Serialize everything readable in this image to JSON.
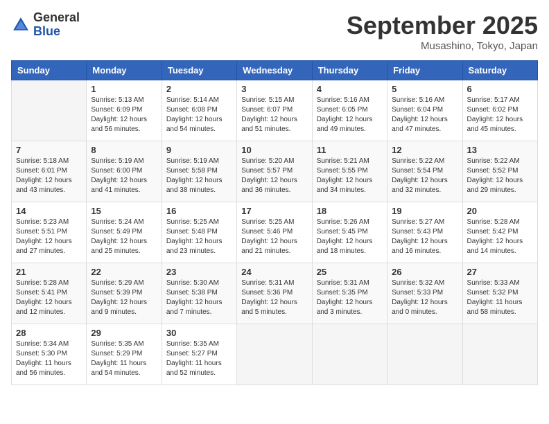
{
  "header": {
    "logo_general": "General",
    "logo_blue": "Blue",
    "month": "September 2025",
    "location": "Musashino, Tokyo, Japan"
  },
  "weekdays": [
    "Sunday",
    "Monday",
    "Tuesday",
    "Wednesday",
    "Thursday",
    "Friday",
    "Saturday"
  ],
  "weeks": [
    [
      {
        "day": "",
        "info": ""
      },
      {
        "day": "1",
        "info": "Sunrise: 5:13 AM\nSunset: 6:09 PM\nDaylight: 12 hours\nand 56 minutes."
      },
      {
        "day": "2",
        "info": "Sunrise: 5:14 AM\nSunset: 6:08 PM\nDaylight: 12 hours\nand 54 minutes."
      },
      {
        "day": "3",
        "info": "Sunrise: 5:15 AM\nSunset: 6:07 PM\nDaylight: 12 hours\nand 51 minutes."
      },
      {
        "day": "4",
        "info": "Sunrise: 5:16 AM\nSunset: 6:05 PM\nDaylight: 12 hours\nand 49 minutes."
      },
      {
        "day": "5",
        "info": "Sunrise: 5:16 AM\nSunset: 6:04 PM\nDaylight: 12 hours\nand 47 minutes."
      },
      {
        "day": "6",
        "info": "Sunrise: 5:17 AM\nSunset: 6:02 PM\nDaylight: 12 hours\nand 45 minutes."
      }
    ],
    [
      {
        "day": "7",
        "info": "Sunrise: 5:18 AM\nSunset: 6:01 PM\nDaylight: 12 hours\nand 43 minutes."
      },
      {
        "day": "8",
        "info": "Sunrise: 5:19 AM\nSunset: 6:00 PM\nDaylight: 12 hours\nand 41 minutes."
      },
      {
        "day": "9",
        "info": "Sunrise: 5:19 AM\nSunset: 5:58 PM\nDaylight: 12 hours\nand 38 minutes."
      },
      {
        "day": "10",
        "info": "Sunrise: 5:20 AM\nSunset: 5:57 PM\nDaylight: 12 hours\nand 36 minutes."
      },
      {
        "day": "11",
        "info": "Sunrise: 5:21 AM\nSunset: 5:55 PM\nDaylight: 12 hours\nand 34 minutes."
      },
      {
        "day": "12",
        "info": "Sunrise: 5:22 AM\nSunset: 5:54 PM\nDaylight: 12 hours\nand 32 minutes."
      },
      {
        "day": "13",
        "info": "Sunrise: 5:22 AM\nSunset: 5:52 PM\nDaylight: 12 hours\nand 29 minutes."
      }
    ],
    [
      {
        "day": "14",
        "info": "Sunrise: 5:23 AM\nSunset: 5:51 PM\nDaylight: 12 hours\nand 27 minutes."
      },
      {
        "day": "15",
        "info": "Sunrise: 5:24 AM\nSunset: 5:49 PM\nDaylight: 12 hours\nand 25 minutes."
      },
      {
        "day": "16",
        "info": "Sunrise: 5:25 AM\nSunset: 5:48 PM\nDaylight: 12 hours\nand 23 minutes."
      },
      {
        "day": "17",
        "info": "Sunrise: 5:25 AM\nSunset: 5:46 PM\nDaylight: 12 hours\nand 21 minutes."
      },
      {
        "day": "18",
        "info": "Sunrise: 5:26 AM\nSunset: 5:45 PM\nDaylight: 12 hours\nand 18 minutes."
      },
      {
        "day": "19",
        "info": "Sunrise: 5:27 AM\nSunset: 5:43 PM\nDaylight: 12 hours\nand 16 minutes."
      },
      {
        "day": "20",
        "info": "Sunrise: 5:28 AM\nSunset: 5:42 PM\nDaylight: 12 hours\nand 14 minutes."
      }
    ],
    [
      {
        "day": "21",
        "info": "Sunrise: 5:28 AM\nSunset: 5:41 PM\nDaylight: 12 hours\nand 12 minutes."
      },
      {
        "day": "22",
        "info": "Sunrise: 5:29 AM\nSunset: 5:39 PM\nDaylight: 12 hours\nand 9 minutes."
      },
      {
        "day": "23",
        "info": "Sunrise: 5:30 AM\nSunset: 5:38 PM\nDaylight: 12 hours\nand 7 minutes."
      },
      {
        "day": "24",
        "info": "Sunrise: 5:31 AM\nSunset: 5:36 PM\nDaylight: 12 hours\nand 5 minutes."
      },
      {
        "day": "25",
        "info": "Sunrise: 5:31 AM\nSunset: 5:35 PM\nDaylight: 12 hours\nand 3 minutes."
      },
      {
        "day": "26",
        "info": "Sunrise: 5:32 AM\nSunset: 5:33 PM\nDaylight: 12 hours\nand 0 minutes."
      },
      {
        "day": "27",
        "info": "Sunrise: 5:33 AM\nSunset: 5:32 PM\nDaylight: 11 hours\nand 58 minutes."
      }
    ],
    [
      {
        "day": "28",
        "info": "Sunrise: 5:34 AM\nSunset: 5:30 PM\nDaylight: 11 hours\nand 56 minutes."
      },
      {
        "day": "29",
        "info": "Sunrise: 5:35 AM\nSunset: 5:29 PM\nDaylight: 11 hours\nand 54 minutes."
      },
      {
        "day": "30",
        "info": "Sunrise: 5:35 AM\nSunset: 5:27 PM\nDaylight: 11 hours\nand 52 minutes."
      },
      {
        "day": "",
        "info": ""
      },
      {
        "day": "",
        "info": ""
      },
      {
        "day": "",
        "info": ""
      },
      {
        "day": "",
        "info": ""
      }
    ]
  ]
}
